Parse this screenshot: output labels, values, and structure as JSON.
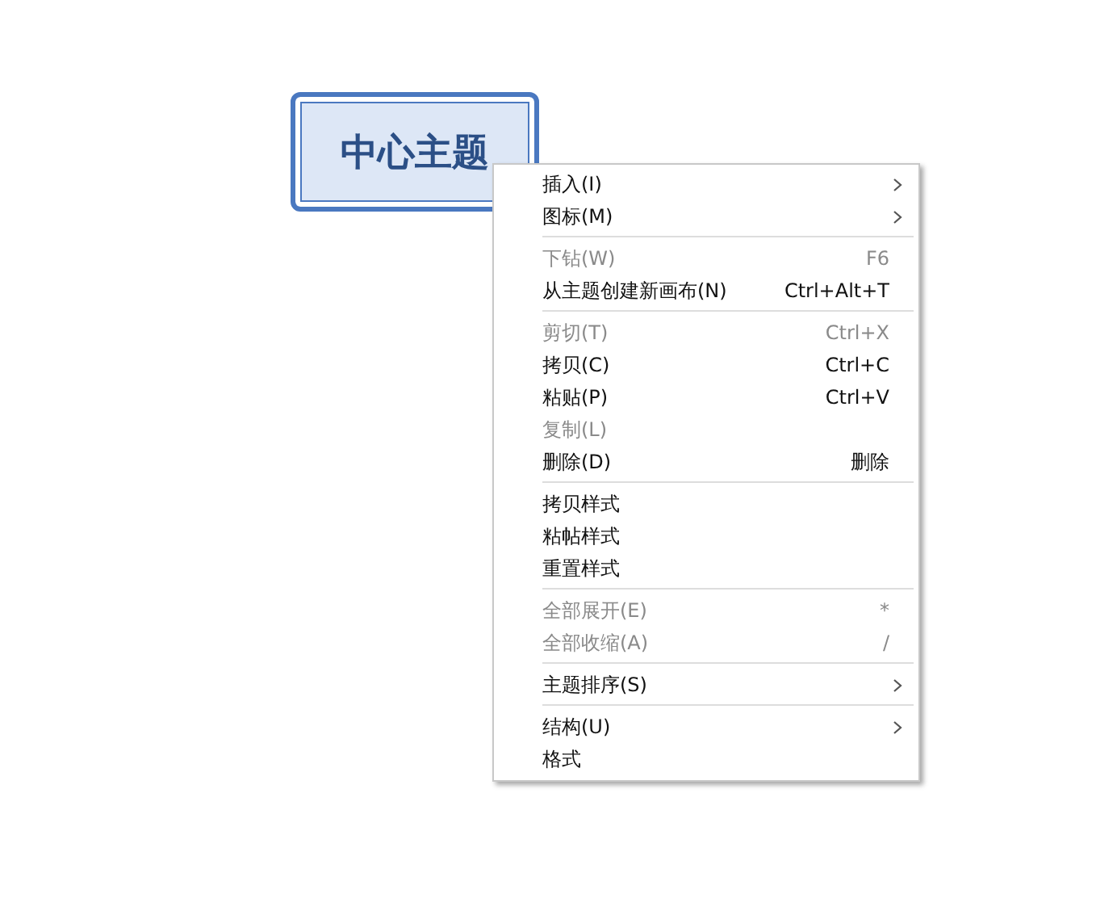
{
  "topic": {
    "label": "中心主题",
    "selected": true
  },
  "context_menu": {
    "groups": [
      {
        "items": [
          {
            "label": "插入(I)",
            "submenu": true,
            "disabled": false
          },
          {
            "label": "图标(M)",
            "submenu": true,
            "disabled": false
          }
        ]
      },
      {
        "items": [
          {
            "label": "下钻(W)",
            "shortcut": "F6",
            "submenu": false,
            "disabled": true
          },
          {
            "label": "从主题创建新画布(N)",
            "shortcut": "Ctrl+Alt+T",
            "submenu": false,
            "disabled": false
          }
        ]
      },
      {
        "items": [
          {
            "label": "剪切(T)",
            "shortcut": "Ctrl+X",
            "submenu": false,
            "disabled": true
          },
          {
            "label": "拷贝(C)",
            "shortcut": "Ctrl+C",
            "submenu": false,
            "disabled": false
          },
          {
            "label": "粘贴(P)",
            "shortcut": "Ctrl+V",
            "submenu": false,
            "disabled": false
          },
          {
            "label": "复制(L)",
            "submenu": false,
            "disabled": true
          },
          {
            "label": "删除(D)",
            "shortcut": "删除",
            "submenu": false,
            "disabled": false
          }
        ]
      },
      {
        "items": [
          {
            "label": "拷贝样式",
            "submenu": false,
            "disabled": false
          },
          {
            "label": "粘帖样式",
            "submenu": false,
            "disabled": false
          },
          {
            "label": "重置样式",
            "submenu": false,
            "disabled": false
          }
        ]
      },
      {
        "items": [
          {
            "label": "全部展开(E)",
            "shortcut": "*",
            "submenu": false,
            "disabled": true
          },
          {
            "label": "全部收缩(A)",
            "shortcut": "/",
            "submenu": false,
            "disabled": true
          }
        ]
      },
      {
        "items": [
          {
            "label": "主题排序(S)",
            "submenu": true,
            "disabled": false
          }
        ]
      },
      {
        "items": [
          {
            "label": "结构(U)",
            "submenu": true,
            "disabled": false
          },
          {
            "label": "格式",
            "submenu": false,
            "disabled": false
          }
        ]
      }
    ]
  }
}
